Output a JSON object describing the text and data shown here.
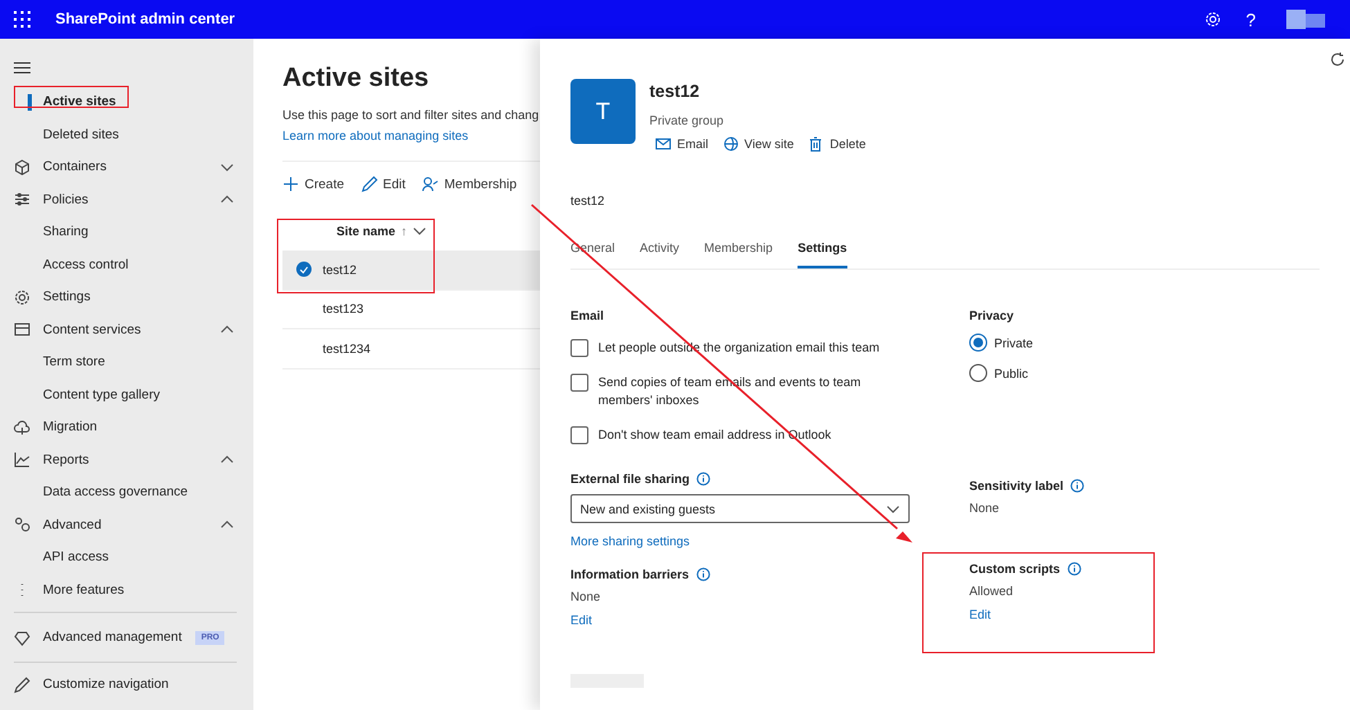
{
  "top_bar": {
    "title": "SharePoint admin center",
    "help": "?"
  },
  "sidebar": {
    "items": [
      {
        "label": "Active sites",
        "selected": true,
        "highlighted": true
      },
      {
        "label": "Deleted sites",
        "selected": false
      },
      {
        "label": "Containers",
        "expanded": false
      },
      {
        "label": "Policies",
        "expanded": true,
        "children": [
          {
            "label": "Sharing",
            "selected": false
          },
          {
            "label": "Access control",
            "selected": false
          }
        ]
      },
      {
        "label": "Settings"
      },
      {
        "label": "Content services",
        "expanded": true,
        "children": [
          {
            "label": "Term store",
            "selected": false
          },
          {
            "label": "Content type gallery",
            "selected": false
          }
        ]
      },
      {
        "label": "Migration"
      },
      {
        "label": "Reports",
        "expanded": true,
        "children": [
          {
            "label": "Data access governance",
            "selected": false
          }
        ]
      },
      {
        "label": "Advanced",
        "expanded": true,
        "children": [
          {
            "label": "API access",
            "selected": false
          }
        ]
      },
      {
        "label": "More features"
      }
    ],
    "advanced_management": {
      "label": "Advanced management",
      "badge": "PRO"
    },
    "customize": "Customize navigation"
  },
  "main": {
    "title": "Active sites",
    "description": "Use this page to sort and filter sites and chang",
    "link": "Learn more about managing sites",
    "toolbar": [
      "Create",
      "Edit",
      "Membership"
    ],
    "table": {
      "column": "Site name",
      "sort_arrow": "↑",
      "highlighted": true,
      "rows": [
        {
          "name": "test12",
          "selected": true
        },
        {
          "name": "test123",
          "selected": false
        },
        {
          "name": "test1234",
          "selected": false
        }
      ]
    }
  },
  "panel": {
    "avatar": "T",
    "name": "test12",
    "subtitle": "Private group",
    "actions": [
      "Email",
      "View site",
      "Delete"
    ],
    "site_label": "test12",
    "tabs": [
      {
        "label": "General",
        "selected": false
      },
      {
        "label": "Activity",
        "selected": false
      },
      {
        "label": "Membership",
        "selected": false
      },
      {
        "label": "Settings",
        "selected": true
      }
    ],
    "email": {
      "heading": "Email",
      "options": [
        {
          "label": "Let people outside the organization email this team",
          "checked": false
        },
        {
          "label": "Send copies of team emails and events to team members' inboxes",
          "checked": false
        },
        {
          "label": "Don't show team email address in Outlook",
          "checked": false
        }
      ]
    },
    "privacy": {
      "heading": "Privacy",
      "options": [
        {
          "label": "Private",
          "selected": true
        },
        {
          "label": "Public",
          "selected": false
        }
      ]
    },
    "external_sharing": {
      "heading": "External file sharing",
      "value": "New and existing guests",
      "link": "More sharing settings"
    },
    "sensitivity": {
      "heading": "Sensitivity label",
      "value": "None"
    },
    "information_barriers": {
      "heading": "Information barriers",
      "value": "None",
      "link": "Edit"
    },
    "custom_scripts": {
      "heading": "Custom scripts",
      "value": "Allowed",
      "link": "Edit",
      "highlighted": true
    }
  }
}
